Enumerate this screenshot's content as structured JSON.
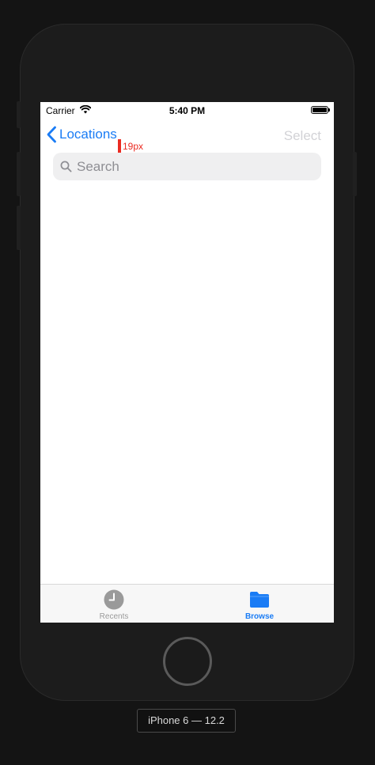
{
  "status_bar": {
    "carrier": "Carrier",
    "time": "5:40 PM"
  },
  "nav_bar": {
    "back_label": "Locations",
    "select_label": "Select"
  },
  "measurement": {
    "label": "19px"
  },
  "search": {
    "placeholder": "Search"
  },
  "tab_bar": {
    "tabs": [
      {
        "label": "Recents",
        "icon": "clock-icon",
        "selected": false
      },
      {
        "label": "Browse",
        "icon": "folder-icon",
        "selected": true
      }
    ]
  },
  "device": {
    "label": "iPhone 6 — 12.2"
  },
  "colors": {
    "accent": "#1a7cf5",
    "disabled": "#d2d2d6",
    "measure": "#ea2b22"
  }
}
